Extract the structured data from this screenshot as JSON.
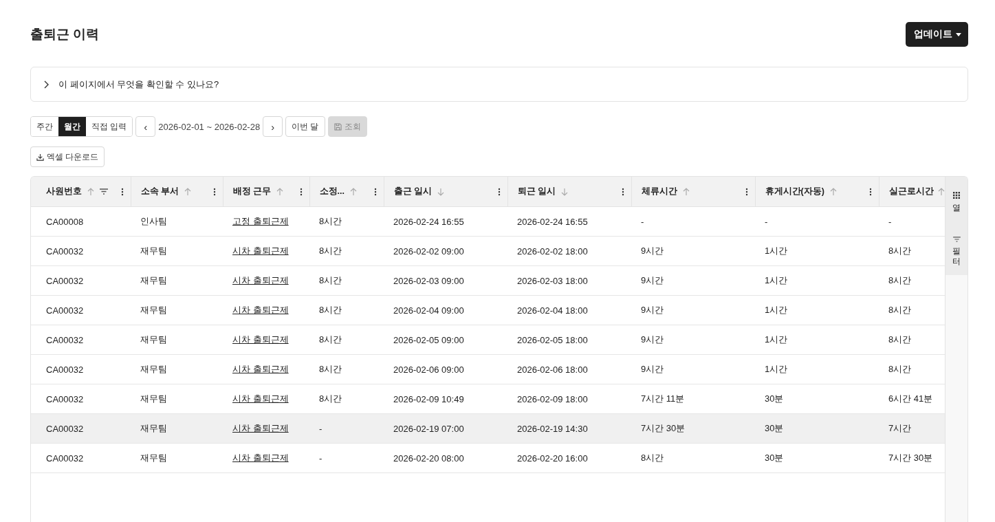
{
  "page": {
    "title": "출퇴근 이력",
    "update_button": "업데이트"
  },
  "help": {
    "text": "이 페이지에서 무엇을 확인할 수 있나요?",
    "expanded": false
  },
  "period_tabs": [
    {
      "label": "주간",
      "selected": false
    },
    {
      "label": "월간",
      "selected": true
    },
    {
      "label": "직접 입력",
      "selected": false
    }
  ],
  "date_range": {
    "prev": "‹",
    "value": "2026-02-01 ~ 2026-02-28",
    "next": "›"
  },
  "this_month_button": "이번 달",
  "search_button": {
    "label": "조회",
    "disabled": true
  },
  "excel_button": "엑셀 다운로드",
  "table": {
    "columns": [
      {
        "label": "사원번호",
        "kind": "text",
        "descending": false,
        "filter": true,
        "menu": true
      },
      {
        "label": "소속 부서",
        "kind": "text",
        "descending": false,
        "filter": false,
        "menu": true
      },
      {
        "label": "배정 근무",
        "kind": "link",
        "descending": false,
        "filter": false,
        "menu": true
      },
      {
        "label": "소정...",
        "kind": "text",
        "descending": false,
        "filter": false,
        "menu": true
      },
      {
        "label": "출근 일시",
        "kind": "text",
        "descending": true,
        "filter": false,
        "menu": true
      },
      {
        "label": "퇴근 일시",
        "kind": "text",
        "descending": true,
        "filter": false,
        "menu": true
      },
      {
        "label": "체류시간",
        "kind": "text",
        "descending": false,
        "filter": false,
        "menu": true
      },
      {
        "label": "휴게시간(자동)",
        "kind": "text",
        "descending": false,
        "filter": false,
        "menu": true
      },
      {
        "label": "실근로시간",
        "kind": "text",
        "descending": false,
        "filter": false,
        "menu": false
      }
    ],
    "rows": [
      {
        "selected": false,
        "cells": [
          "CA00008",
          "인사팀",
          "고정 출퇴근제",
          "8시간",
          "2026-02-24 16:55",
          "2026-02-24 16:55",
          "-",
          "-",
          "-"
        ]
      },
      {
        "selected": false,
        "cells": [
          "CA00032",
          "재무팀",
          "시차 출퇴근제",
          "8시간",
          "2026-02-02 09:00",
          "2026-02-02 18:00",
          "9시간",
          "1시간",
          "8시간"
        ]
      },
      {
        "selected": false,
        "cells": [
          "CA00032",
          "재무팀",
          "시차 출퇴근제",
          "8시간",
          "2026-02-03 09:00",
          "2026-02-03 18:00",
          "9시간",
          "1시간",
          "8시간"
        ]
      },
      {
        "selected": false,
        "cells": [
          "CA00032",
          "재무팀",
          "시차 출퇴근제",
          "8시간",
          "2026-02-04 09:00",
          "2026-02-04 18:00",
          "9시간",
          "1시간",
          "8시간"
        ]
      },
      {
        "selected": false,
        "cells": [
          "CA00032",
          "재무팀",
          "시차 출퇴근제",
          "8시간",
          "2026-02-05 09:00",
          "2026-02-05 18:00",
          "9시간",
          "1시간",
          "8시간"
        ]
      },
      {
        "selected": false,
        "cells": [
          "CA00032",
          "재무팀",
          "시차 출퇴근제",
          "8시간",
          "2026-02-06 09:00",
          "2026-02-06 18:00",
          "9시간",
          "1시간",
          "8시간"
        ]
      },
      {
        "selected": false,
        "cells": [
          "CA00032",
          "재무팀",
          "시차 출퇴근제",
          "8시간",
          "2026-02-09 10:49",
          "2026-02-09 18:00",
          "7시간 11분",
          "30분",
          "6시간 41분"
        ]
      },
      {
        "selected": true,
        "cells": [
          "CA00032",
          "재무팀",
          "시차 출퇴근제",
          "-",
          "2026-02-19 07:00",
          "2026-02-19 14:30",
          "7시간 30분",
          "30분",
          "7시간"
        ]
      },
      {
        "selected": false,
        "cells": [
          "CA00032",
          "재무팀",
          "시차 출퇴근제",
          "-",
          "2026-02-20 08:00",
          "2026-02-20 16:00",
          "8시간",
          "30분",
          "7시간 30분"
        ]
      }
    ]
  },
  "side_panel": [
    {
      "kind": "columns",
      "label": "열",
      "selected": true
    },
    {
      "kind": "filters",
      "label": "필터",
      "selected": true
    }
  ]
}
